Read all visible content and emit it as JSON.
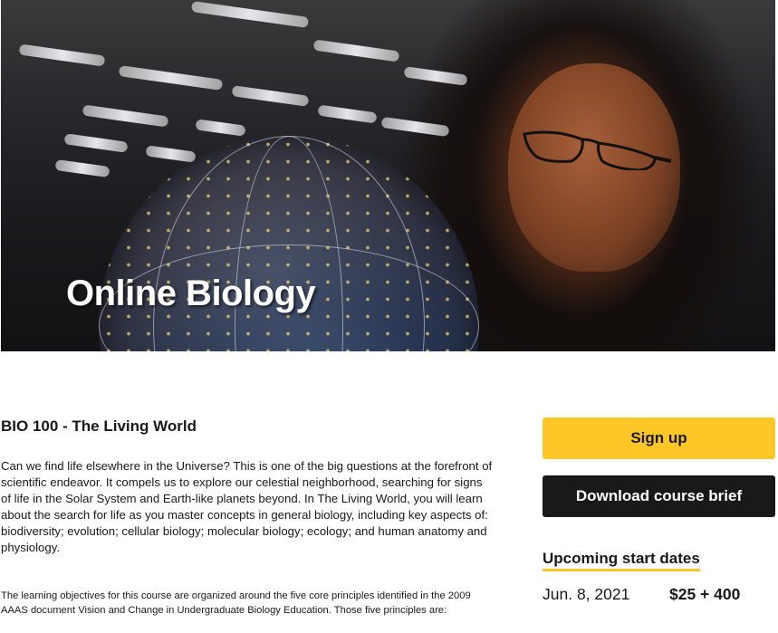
{
  "hero": {
    "title": "Online Biology"
  },
  "course": {
    "title": "BIO 100 - The Living World",
    "description": "Can we find life elsewhere in the Universe? This is one of the big questions at the forefront of scientific endeavor. It compels us to explore our celestial neighborhood, searching for signs of life in the Solar System and Earth-like planets beyond. In The Living World, you will learn about the search for life as you master concepts in general biology, including key aspects of: biodiversity; evolution; cellular biology; molecular biology; ecology; and human anatomy and physiology.",
    "objectives": "The learning objectives for this course are organized around the five core principles identified in the 2009 AAAS document Vision and Change in Undergraduate Biology Education. Those five principles are:"
  },
  "sidebar": {
    "signup_label": "Sign up",
    "brief_label": "Download course brief",
    "upcoming_heading": "Upcoming start dates",
    "start_dates": [
      {
        "date": "Jun. 8, 2021",
        "price": "$25 + 400"
      }
    ]
  },
  "colors": {
    "accent": "#ffc627",
    "dark": "#191919"
  }
}
